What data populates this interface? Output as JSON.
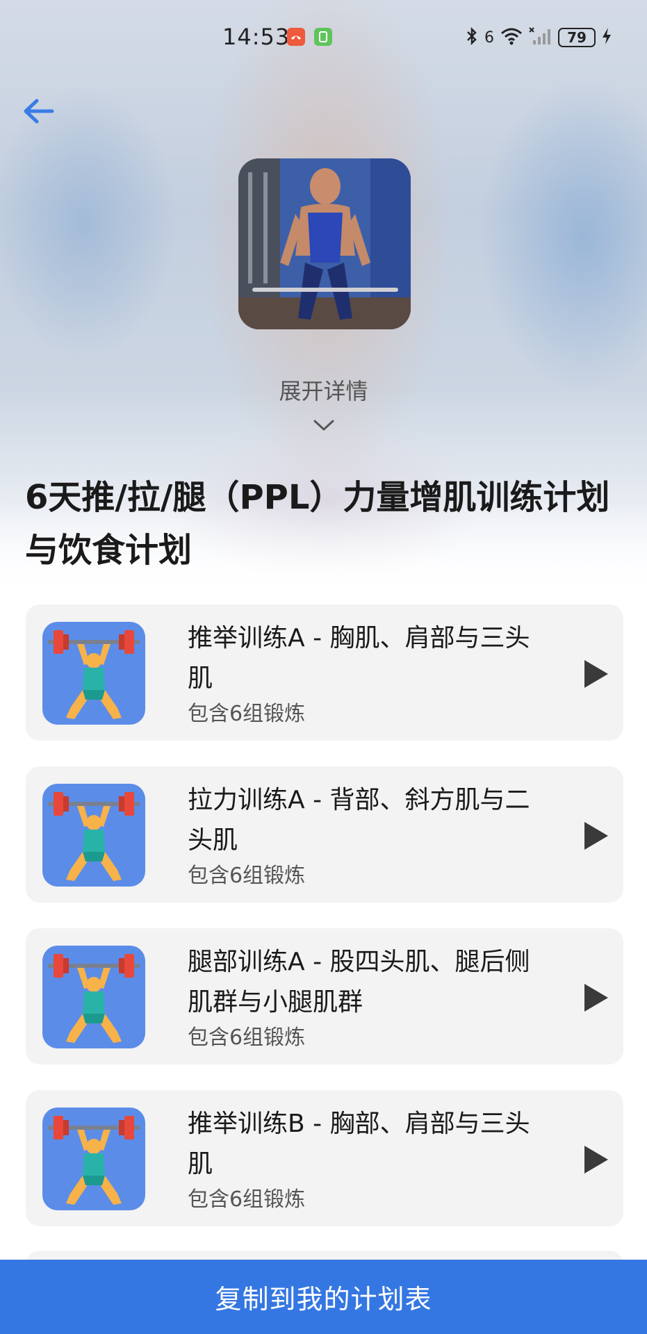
{
  "status_bar": {
    "time": "14:53",
    "battery": "79",
    "signal_label": "6"
  },
  "header": {
    "back_icon": "arrow-left-icon",
    "expand_label": "展开详情",
    "expand_icon": "chevron-down-icon"
  },
  "plan": {
    "title": "6天推/拉/腿（PPL）力量增肌训练计划与饮食计划"
  },
  "workouts": [
    {
      "name": "推举训练A - 胸肌、肩部与三头肌",
      "sub": "包含6组锻炼",
      "icon": "weightlifter-icon"
    },
    {
      "name": "拉力训练A - 背部、斜方肌与二头肌",
      "sub": "包含6组锻炼",
      "icon": "weightlifter-icon"
    },
    {
      "name": "腿部训练A - 股四头肌、腿后侧肌群与小腿肌群",
      "sub": "包含6组锻炼",
      "icon": "weightlifter-icon"
    },
    {
      "name": "推举训练B - 胸部、肩部与三头肌",
      "sub": "包含6组锻炼",
      "icon": "weightlifter-icon"
    }
  ],
  "footer": {
    "copy_label": "复制到我的计划表"
  },
  "colors": {
    "accent": "#3577e2",
    "card_bg": "#f3f3f4",
    "thumb_bg": "#5b8de8"
  }
}
